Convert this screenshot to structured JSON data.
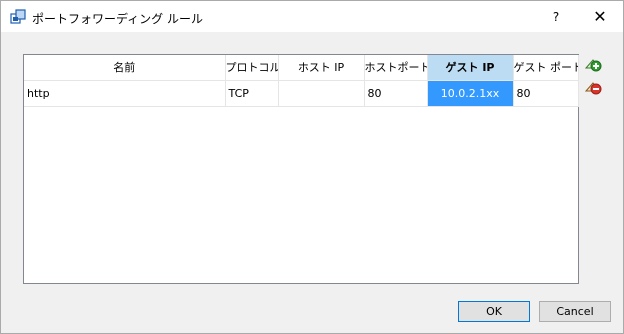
{
  "window": {
    "title": "ポートフォワーディング ルール",
    "help_label": "?",
    "close_label": "✕"
  },
  "table": {
    "columns": [
      "名前",
      "プロトコル",
      "ホスト IP",
      "ホストポート",
      "ゲスト IP",
      "ゲスト ポート"
    ],
    "rows": [
      {
        "name": "http",
        "protocol": "TCP",
        "host_ip": "",
        "host_port": "80",
        "guest_ip": "10.0.2.1xx",
        "guest_port": "80"
      }
    ],
    "sorted_column": "ゲスト IP"
  },
  "side_buttons": [
    "add-rule-icon",
    "remove-rule-icon"
  ],
  "buttons": {
    "ok": "OK",
    "cancel": "Cancel"
  },
  "colors": {
    "selection": "#3399ff",
    "sorted_header": "#bcdcf4",
    "plus": "#2e9e2e",
    "minus": "#d9342b"
  }
}
